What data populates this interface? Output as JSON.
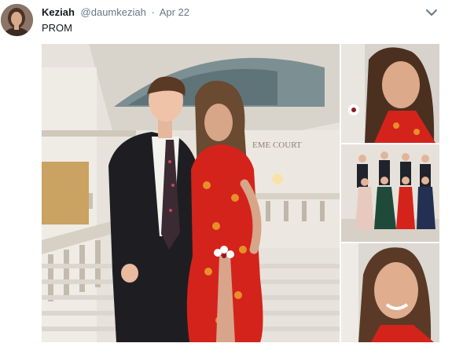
{
  "tweet": {
    "display_name": "Keziah",
    "handle": "@daumkeziah",
    "separator": "·",
    "date": "Apr 22",
    "text": "PROM"
  },
  "icons": {
    "menu": "chevron-down-icon",
    "avatar": "avatar"
  },
  "media": {
    "main_caption": "EME COURT",
    "photo_count": 4
  },
  "colors": {
    "name": "#14171a",
    "muted": "#657786",
    "dress_red": "#d4231b"
  }
}
